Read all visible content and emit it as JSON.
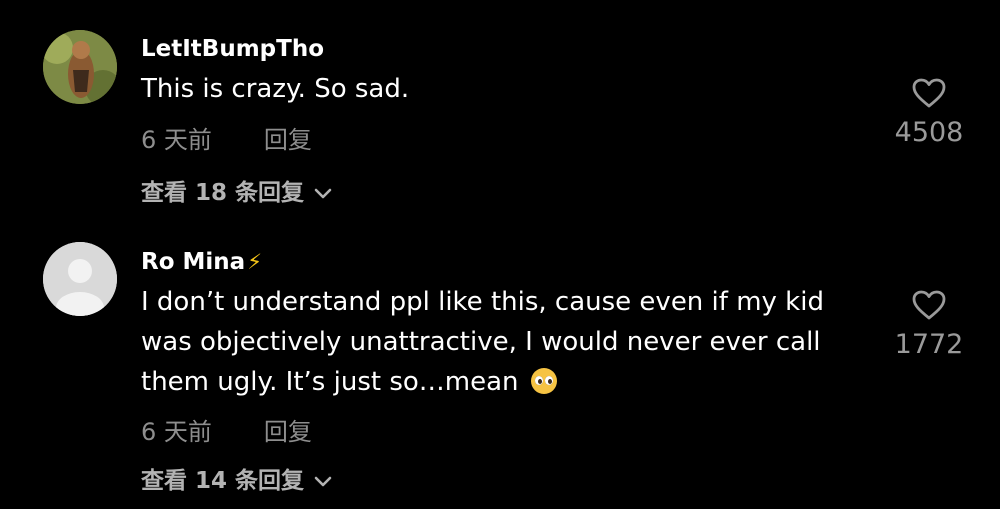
{
  "comments": [
    {
      "username": "LetItBumpTho",
      "text": "This is crazy. So sad.",
      "time": "6 天前",
      "reply_label": "回复",
      "view_replies": "查看 18 条回复",
      "likes": "4508",
      "avatar": "avatar-photo"
    },
    {
      "username": "Ro Mina",
      "badge": "⚡",
      "text": "I don’t understand ppl like this, cause even if my kid was objectively unattractive, I would never ever call them ugly. It’s just so…mean",
      "emoji": "pleading-face-emoji",
      "time": "6 天前",
      "reply_label": "回复",
      "view_replies": "查看 14 条回复",
      "likes": "1772",
      "avatar": "default-avatar"
    }
  ],
  "colors": {
    "background": "#000000",
    "text": "#ffffff",
    "muted": "#8e8e8e",
    "badge": "#f5c518"
  }
}
